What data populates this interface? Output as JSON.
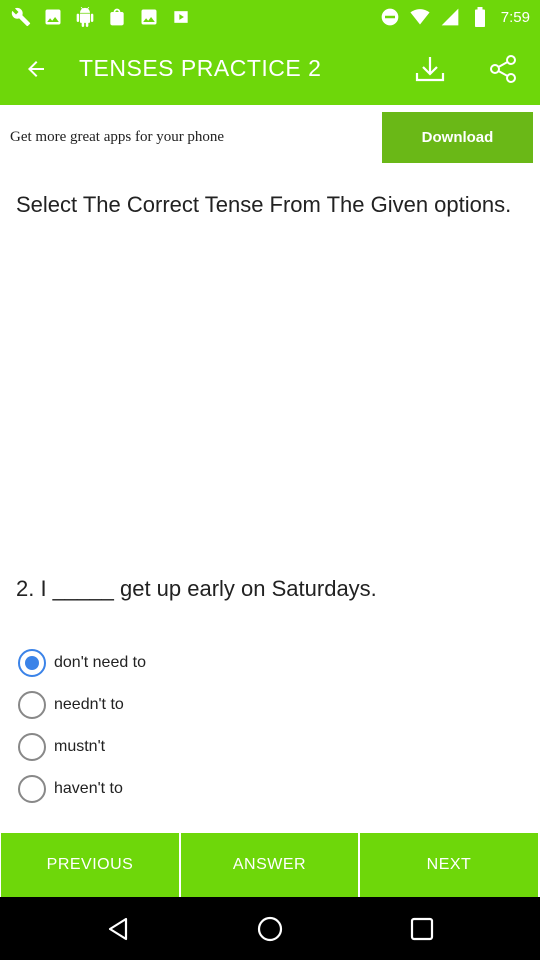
{
  "status_bar": {
    "time": "7:59",
    "left_icons": [
      "wrench-icon",
      "image-icon",
      "android-icon",
      "bag-icon",
      "image-icon",
      "play-icon"
    ],
    "right_icons": [
      "do-not-disturb-icon",
      "wifi-icon",
      "cellular-icon",
      "battery-icon"
    ]
  },
  "app_bar": {
    "title": "TENSES PRACTICE 2",
    "color": "#6ed70a"
  },
  "ad": {
    "text": "Get more great apps for your phone",
    "button_label": "Download",
    "button_color": "#6ab817"
  },
  "quiz": {
    "instruction": "Select The Correct Tense From The Given options.",
    "question": "2. I _____ get up early on Saturdays.",
    "options": [
      {
        "label": "don't need to",
        "selected": true
      },
      {
        "label": "needn't to",
        "selected": false
      },
      {
        "label": "mustn't",
        "selected": false
      },
      {
        "label": "haven't to",
        "selected": false
      }
    ],
    "selected_color": "#3b83e8"
  },
  "actions": {
    "previous": "PREVIOUS",
    "answer": "ANSWER",
    "next": "NEXT"
  }
}
